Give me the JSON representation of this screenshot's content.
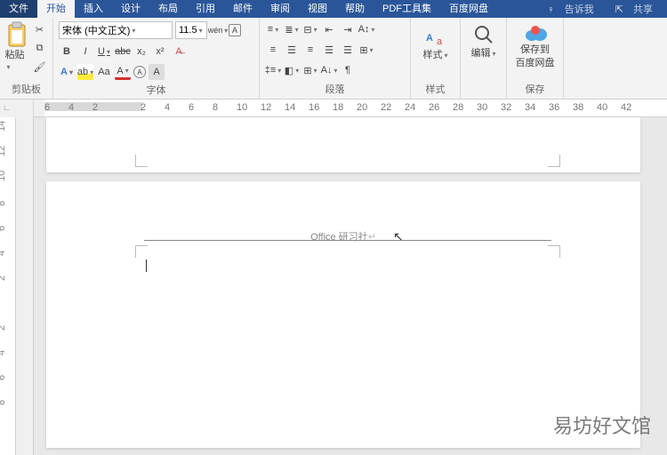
{
  "tabs": {
    "file": "文件",
    "home": "开始",
    "insert": "插入",
    "design": "设计",
    "layout": "布局",
    "references": "引用",
    "mail": "邮件",
    "review": "审阅",
    "view": "视图",
    "help": "帮助",
    "pdf": "PDF工具集",
    "netdisk": "百度网盘",
    "tellme": "告诉我",
    "share": "共享"
  },
  "ribbon": {
    "clipboard": {
      "paste": "粘贴",
      "label": "剪贴板"
    },
    "font": {
      "name": "宋体 (中文正文)",
      "size": "11.5",
      "wen": "wén",
      "label": "字体"
    },
    "paragraph": {
      "label": "段落"
    },
    "styles": {
      "btn": "样式",
      "label": "样式"
    },
    "edit": {
      "btn": "编辑"
    },
    "netdisk": {
      "line1": "保存到",
      "line2": "百度网盘",
      "label": "保存"
    }
  },
  "ruler": {
    "ticks": [
      "6",
      "4",
      "2",
      "",
      "2",
      "4",
      "6",
      "8",
      "10",
      "12",
      "14",
      "16",
      "18",
      "20",
      "22",
      "24",
      "26",
      "28",
      "30",
      "32",
      "34",
      "36",
      "38",
      "40",
      "42"
    ]
  },
  "vruler": {
    "ticks": [
      "14",
      "12",
      "10",
      "8",
      "6",
      "4",
      "2",
      "",
      "2",
      "4",
      "6",
      "8"
    ]
  },
  "document": {
    "header_text": "Office 研习社"
  },
  "watermark": "易坊好文馆"
}
